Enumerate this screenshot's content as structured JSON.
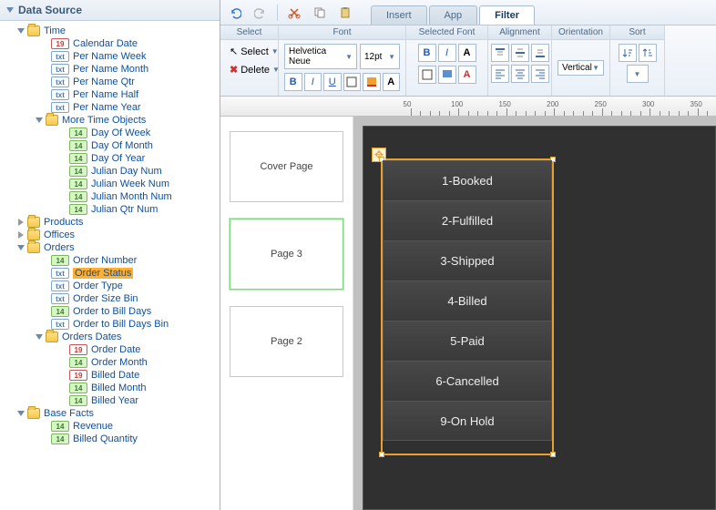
{
  "sidebar": {
    "title": "Data Source",
    "tree": {
      "time": {
        "label": "Time",
        "items": [
          {
            "icon": "cal",
            "label": "Calendar Date"
          },
          {
            "icon": "txt",
            "label": "Per Name Week"
          },
          {
            "icon": "txt",
            "label": "Per Name Month"
          },
          {
            "icon": "txt",
            "label": "Per Name Qtr"
          },
          {
            "icon": "txt",
            "label": "Per Name Half"
          },
          {
            "icon": "txt",
            "label": "Per Name Year"
          }
        ],
        "more_time": {
          "label": "More Time Objects",
          "items": [
            {
              "icon": "num",
              "label": "Day Of Week"
            },
            {
              "icon": "num",
              "label": "Day Of Month"
            },
            {
              "icon": "num",
              "label": "Day Of Year"
            },
            {
              "icon": "num",
              "label": "Julian Day Num"
            },
            {
              "icon": "num",
              "label": "Julian Week Num"
            },
            {
              "icon": "num",
              "label": "Julian Month Num"
            },
            {
              "icon": "num",
              "label": "Julian Qtr Num"
            }
          ]
        }
      },
      "products": {
        "label": "Products"
      },
      "offices": {
        "label": "Offices"
      },
      "orders": {
        "label": "Orders",
        "items": [
          {
            "icon": "num",
            "label": "Order Number"
          },
          {
            "icon": "txt",
            "label": "Order Status",
            "highlighted": true
          },
          {
            "icon": "txt",
            "label": "Order Type"
          },
          {
            "icon": "txt",
            "label": "Order Size Bin"
          },
          {
            "icon": "num",
            "label": "Order to Bill Days"
          },
          {
            "icon": "txt",
            "label": "Order to Bill Days Bin"
          }
        ],
        "dates": {
          "label": "Orders Dates",
          "items": [
            {
              "icon": "cal",
              "label": "Order Date"
            },
            {
              "icon": "num",
              "label": "Order Month"
            },
            {
              "icon": "cal",
              "label": "Billed Date"
            },
            {
              "icon": "num",
              "label": "Billed Month"
            },
            {
              "icon": "num",
              "label": "Billed Year"
            }
          ]
        }
      },
      "base_facts": {
        "label": "Base Facts",
        "items": [
          {
            "icon": "num",
            "label": "Revenue"
          },
          {
            "icon": "num",
            "label": "Billed Quantity"
          }
        ]
      }
    }
  },
  "tabs": {
    "insert": "Insert",
    "app": "App",
    "filter": "Filter"
  },
  "ribbon": {
    "select": {
      "title": "Select",
      "select_label": "Select",
      "delete_label": "Delete"
    },
    "font": {
      "title": "Font",
      "family": "Helvetica Neue",
      "size": "12pt",
      "bold": "B",
      "italic": "I",
      "underline": "U"
    },
    "selfont": {
      "title": "Selected Font",
      "bold": "B",
      "italic": "I"
    },
    "align": {
      "title": "Alignment"
    },
    "orient": {
      "title": "Orientation",
      "label": "Vertical"
    },
    "sort": {
      "title": "Sort"
    }
  },
  "ruler": {
    "marks": [
      50,
      100,
      150,
      200,
      250,
      300,
      350
    ]
  },
  "pages": [
    {
      "label": "Cover Page"
    },
    {
      "label": "Page 3",
      "selected": true
    },
    {
      "label": "Page 2"
    }
  ],
  "filter_values": [
    "1-Booked",
    "2-Fulfilled",
    "3-Shipped",
    "4-Billed",
    "5-Paid",
    "6-Cancelled",
    "9-On Hold"
  ],
  "badge_text": {
    "cal": "19",
    "txt": "txt",
    "num": "14"
  }
}
